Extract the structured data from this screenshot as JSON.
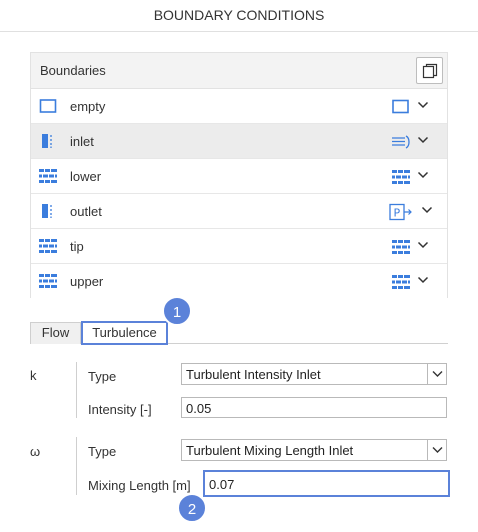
{
  "title": "BOUNDARY CONDITIONS",
  "boundaries": {
    "header": "Boundaries",
    "items": [
      {
        "label": "empty",
        "icon": "empty-patch-icon",
        "type_icon": "empty-type-icon"
      },
      {
        "label": "inlet",
        "icon": "patch-icon",
        "type_icon": "inlet-flow-icon"
      },
      {
        "label": "lower",
        "icon": "wall-icon",
        "type_icon": "wall-type-icon"
      },
      {
        "label": "outlet",
        "icon": "patch-icon",
        "type_icon": "pressure-outlet-icon"
      },
      {
        "label": "tip",
        "icon": "wall-icon",
        "type_icon": "wall-type-icon"
      },
      {
        "label": "upper",
        "icon": "wall-icon",
        "type_icon": "wall-type-icon"
      }
    ],
    "selected": "inlet"
  },
  "tabs": [
    {
      "label": "Flow"
    },
    {
      "label": "Turbulence"
    }
  ],
  "active_tab": "Turbulence",
  "callouts": [
    "1",
    "2"
  ],
  "k_section": {
    "symbol": "k",
    "type_label": "Type",
    "type_value": "Turbulent Intensity Inlet",
    "param_label": "Intensity [-]",
    "param_value": "0.05"
  },
  "omega_section": {
    "symbol": "ω",
    "type_label": "Type",
    "type_value": "Turbulent Mixing Length Inlet",
    "param_label": "Mixing Length [m]",
    "param_value": "0.07"
  },
  "colors": {
    "accent": "#5b82d9",
    "icon_blue": "#3b7ddd"
  }
}
